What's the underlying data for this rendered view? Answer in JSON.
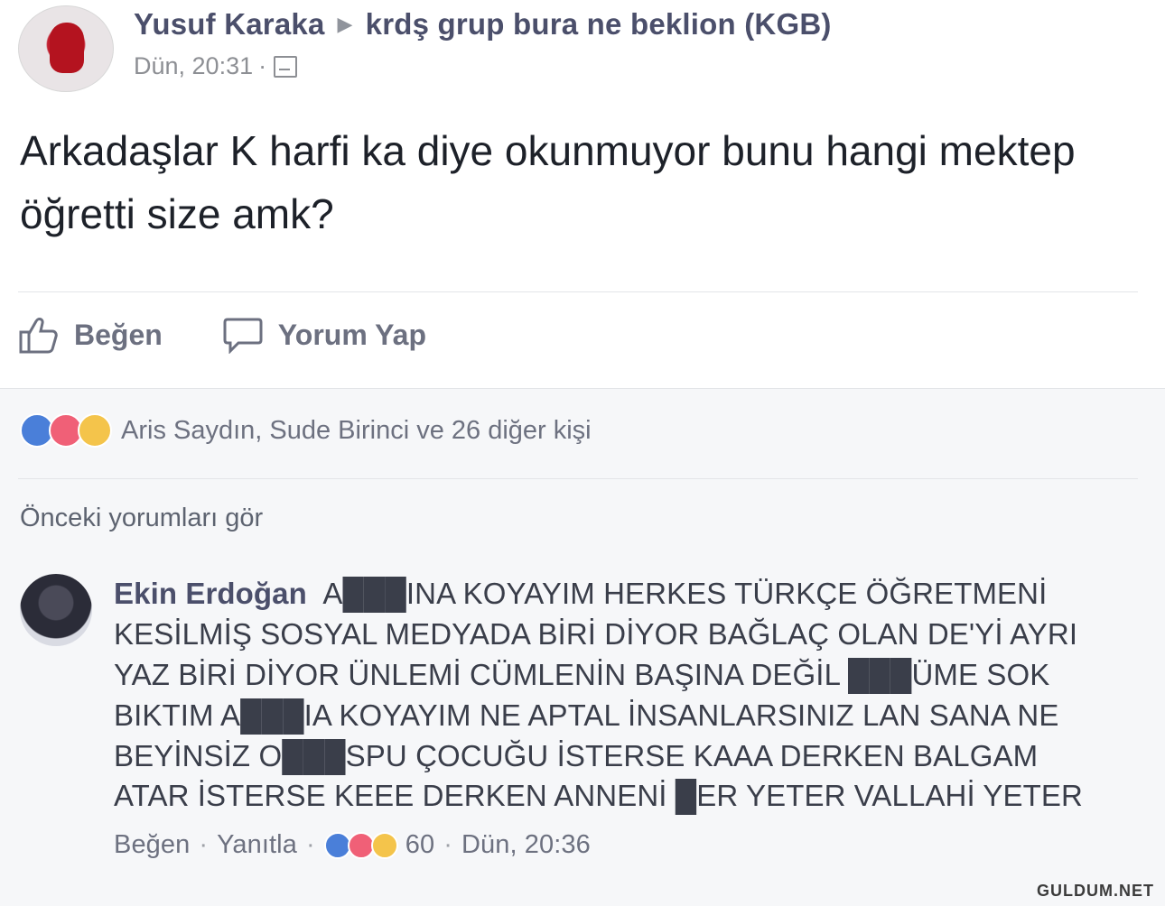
{
  "post": {
    "author": "Yusuf Karaka",
    "group": "krdş grup bura ne beklion (KGB)",
    "time": "Dün, 20:31",
    "text": "Arkadaşlar K harfi ka diye okunmuyor bunu hangi mektep öğretti size amk?"
  },
  "actions": {
    "like_label": "Beğen",
    "comment_label": "Yorum Yap"
  },
  "reactions": {
    "summary": "Aris Saydın, Sude Birinci ve 26 diğer kişi",
    "icons": [
      "like-icon",
      "love-icon",
      "sad-icon"
    ],
    "colors": {
      "like": "#4a7fd9",
      "love": "#f06077",
      "sad": "#f4c44b"
    }
  },
  "previous_comments": "Önceki yorumları gör",
  "comment": {
    "author": "Ekin Erdoğan",
    "text": "A███INA KOYAYIM HERKES TÜRKÇE ÖĞRETMENİ KESİLMİŞ SOSYAL MEDYADA BİRİ DİYOR BAĞLAÇ OLAN DE'Yİ AYRI YAZ BİRİ DİYOR ÜNLEMİ CÜMLENİN BAŞINA DEĞİL ███ÜME SOK BIKTIM A███IA KOYAYIM NE APTAL İNSANLARSINIZ LAN SANA NE BEYİNSİZ O███SPU ÇOCUĞU İSTERSE KAAA DERKEN BALGAM ATAR İSTERSE KEEE DERKEN ANNENİ █ER YETER VALLAHİ YETER",
    "like_label": "Beğen",
    "reply_label": "Yanıtla",
    "reaction_count": "60",
    "time": "Dün, 20:36"
  },
  "watermark": "GULDUM.NET"
}
